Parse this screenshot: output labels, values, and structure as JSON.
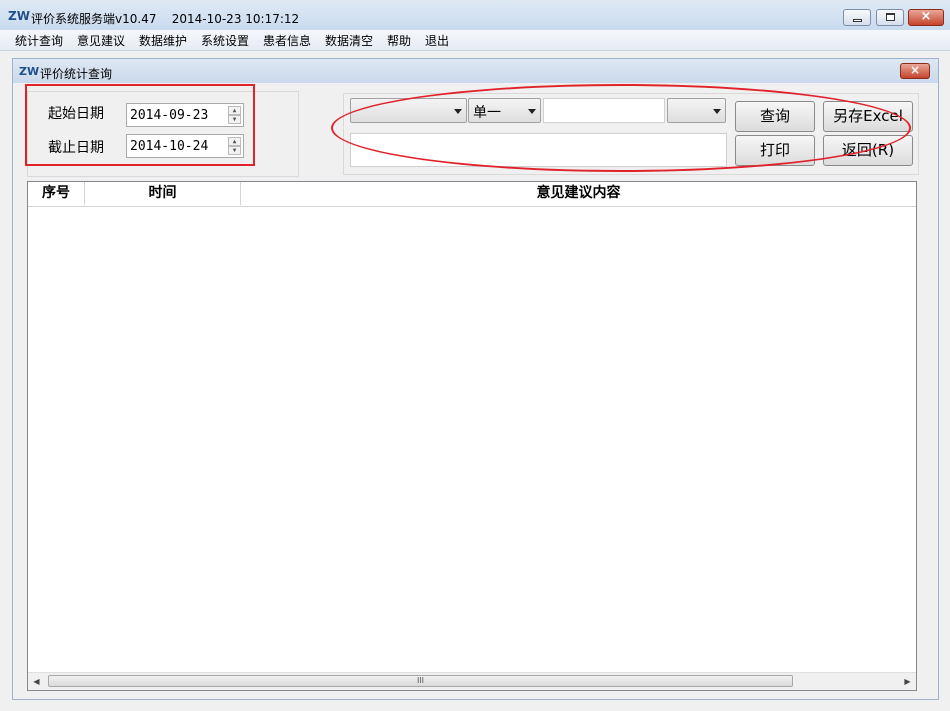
{
  "window": {
    "title": "评价系统服务端v10.47    2014-10-23 10:17:12",
    "icon": "app-logo-icon",
    "icon_text": "ZW",
    "controls": {
      "minimize": "minimize-icon",
      "maximize": "maximize-icon",
      "close": "×"
    }
  },
  "menu": {
    "items": [
      {
        "label": "统计查询"
      },
      {
        "label": "意见建议"
      },
      {
        "label": "数据维护"
      },
      {
        "label": "系统设置"
      },
      {
        "label": "患者信息"
      },
      {
        "label": "数据清空"
      },
      {
        "label": "帮助"
      },
      {
        "label": "退出"
      }
    ]
  },
  "child": {
    "title": "评价统计查询",
    "icon_text": "ZW",
    "close": "×"
  },
  "filters": {
    "start_label": "起始日期",
    "start_value": "2014-09-23",
    "end_label": "截止日期",
    "end_value": "2014-10-24",
    "combo1_value": "",
    "combo2_value": "单一",
    "text1_value": "",
    "combo3_value": "",
    "text2_value": "",
    "spin_up": "▲",
    "spin_down": "▼"
  },
  "buttons": {
    "query": "查询",
    "export": "另存Excel",
    "print": "打印",
    "back": "返回(R)"
  },
  "table": {
    "columns": [
      "序号",
      "时间",
      "意见建议内容"
    ],
    "rows": []
  },
  "scrollbar": {
    "left": "◀",
    "right": "▶",
    "grip": "III"
  },
  "colors": {
    "annotation_red": "#e0232a",
    "titlebar": "#c9dbef"
  }
}
